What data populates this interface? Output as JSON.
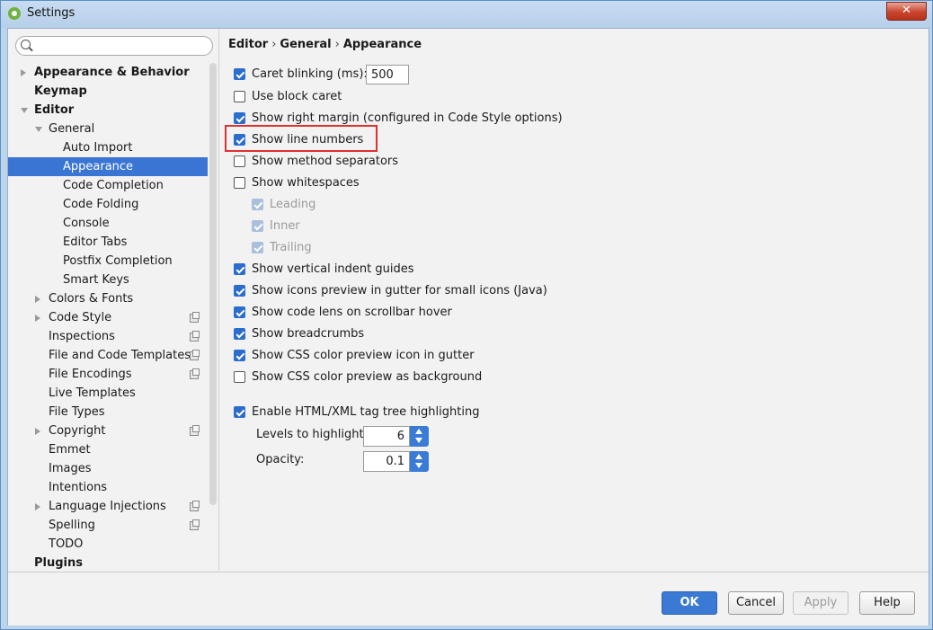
{
  "window": {
    "title": "Settings",
    "close_label": "✕"
  },
  "search": {
    "placeholder": ""
  },
  "sidebar": {
    "items": [
      {
        "label": "Appearance & Behavior",
        "level": 0,
        "bold": true,
        "expand": "collapsed"
      },
      {
        "label": "Keymap",
        "level": 0,
        "bold": true
      },
      {
        "label": "Editor",
        "level": 0,
        "bold": true,
        "expand": "expanded"
      },
      {
        "label": "General",
        "level": 1,
        "expand": "expanded"
      },
      {
        "label": "Auto Import",
        "level": 2
      },
      {
        "label": "Appearance",
        "level": 2,
        "selected": true
      },
      {
        "label": "Code Completion",
        "level": 2
      },
      {
        "label": "Code Folding",
        "level": 2
      },
      {
        "label": "Console",
        "level": 2
      },
      {
        "label": "Editor Tabs",
        "level": 2
      },
      {
        "label": "Postfix Completion",
        "level": 2
      },
      {
        "label": "Smart Keys",
        "level": 2
      },
      {
        "label": "Colors & Fonts",
        "level": 1,
        "expand": "collapsed"
      },
      {
        "label": "Code Style",
        "level": 1,
        "expand": "collapsed",
        "project": true
      },
      {
        "label": "Inspections",
        "level": 1,
        "project": true
      },
      {
        "label": "File and Code Templates",
        "level": 1,
        "project": true
      },
      {
        "label": "File Encodings",
        "level": 1,
        "project": true
      },
      {
        "label": "Live Templates",
        "level": 1
      },
      {
        "label": "File Types",
        "level": 1
      },
      {
        "label": "Copyright",
        "level": 1,
        "expand": "collapsed",
        "project": true
      },
      {
        "label": "Emmet",
        "level": 1
      },
      {
        "label": "Images",
        "level": 1
      },
      {
        "label": "Intentions",
        "level": 1
      },
      {
        "label": "Language Injections",
        "level": 1,
        "expand": "collapsed",
        "project": true
      },
      {
        "label": "Spelling",
        "level": 1,
        "project": true
      },
      {
        "label": "TODO",
        "level": 1
      },
      {
        "label": "Plugins",
        "level": 0,
        "bold": true
      }
    ]
  },
  "breadcrumb": [
    "Editor",
    "General",
    "Appearance"
  ],
  "options": {
    "caret_blinking": {
      "label": "Caret blinking (ms):",
      "checked": true,
      "value": "500"
    },
    "list": [
      {
        "label": "Use block caret",
        "checked": false
      },
      {
        "label": "Show right margin (configured in Code Style options)",
        "checked": true
      },
      {
        "label": "Show line numbers",
        "checked": true,
        "highlighted": true
      },
      {
        "label": "Show method separators",
        "checked": false
      },
      {
        "label": "Show whitespaces",
        "checked": false
      },
      {
        "label": "Leading",
        "checked": true,
        "disabled": true
      },
      {
        "label": "Inner",
        "checked": true,
        "disabled": true
      },
      {
        "label": "Trailing",
        "checked": true,
        "disabled": true
      },
      {
        "label": "Show vertical indent guides",
        "checked": true
      },
      {
        "label": "Show icons preview in gutter for small icons (Java)",
        "checked": true
      },
      {
        "label": "Show code lens on scrollbar hover",
        "checked": true
      },
      {
        "label": "Show breadcrumbs",
        "checked": true
      },
      {
        "label": "Show CSS color preview icon in gutter",
        "checked": true
      },
      {
        "label": "Show CSS color preview as background",
        "checked": false
      }
    ],
    "tag_tree": {
      "label": "Enable HTML/XML tag tree highlighting",
      "checked": true
    },
    "levels": {
      "label": "Levels to highlight:",
      "value": "6"
    },
    "opacity": {
      "label": "Opacity:",
      "value": "0.1"
    }
  },
  "footer": {
    "ok": "OK",
    "cancel": "Cancel",
    "apply": "Apply",
    "help": "Help"
  },
  "colors": {
    "accent": "#3a75d4",
    "highlight_box": "#e03030"
  }
}
